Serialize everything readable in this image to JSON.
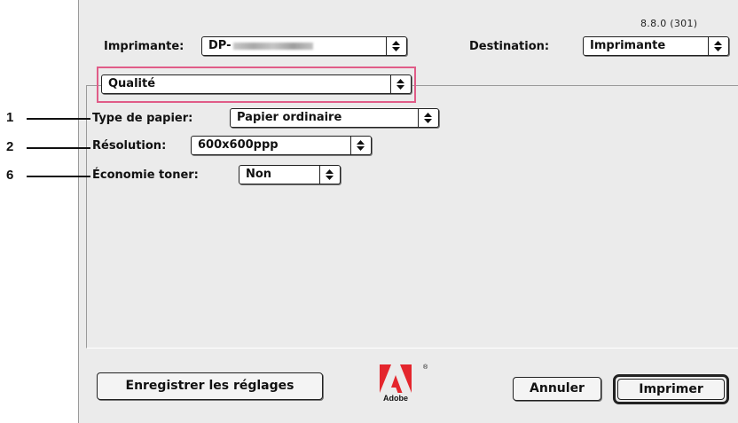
{
  "version": "8.8.0 (301)",
  "printer": {
    "label": "Imprimante:",
    "value_prefix": "DP-"
  },
  "destination": {
    "label": "Destination:",
    "value": "Imprimante"
  },
  "panel_menu": {
    "value": "Qualité"
  },
  "settings": {
    "paper_type": {
      "label": "Type de papier:",
      "value": "Papier ordinaire"
    },
    "resolution": {
      "label": "Résolution:",
      "value": "600x600ppp"
    },
    "toner_saving": {
      "label": "Économie toner:",
      "value": "Non"
    }
  },
  "callouts": [
    "1",
    "2",
    "6"
  ],
  "buttons": {
    "save_settings": "Enregistrer les réglages",
    "cancel": "Annuler",
    "print": "Imprimer"
  },
  "logo": {
    "caption": "Adobe",
    "mark": "®"
  },
  "colors": {
    "highlight": "#e05c88",
    "dialog_bg": "#ebebeb"
  }
}
